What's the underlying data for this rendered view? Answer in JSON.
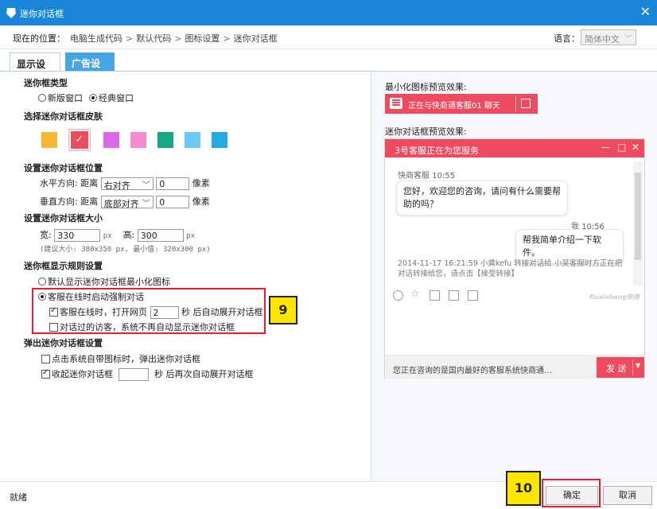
{
  "window": {
    "title": "迷你对话框",
    "close_glyph": "✕"
  },
  "location": {
    "label": "现在的位置：",
    "crumbs": [
      "电脑生成代码",
      "默认代码",
      "图标设置",
      "迷你对话框"
    ],
    "separator": ">",
    "language_label": "语言：",
    "language_value": "简体中文"
  },
  "tabs": [
    {
      "label": "显示设置",
      "active": true
    },
    {
      "label": "广告设置",
      "active": false
    }
  ],
  "settings": {
    "type_title": "迷你框类型",
    "type_options": [
      {
        "label": "新版窗口",
        "selected": false
      },
      {
        "label": "经典窗口",
        "selected": true
      }
    ],
    "skin_title": "选择迷你对话框皮肤",
    "skin_colors": [
      "#f7b731",
      "#ef4b5e",
      "#d66be6",
      "#f38bd0",
      "#16a883",
      "#6dc8f5",
      "#27a9e5"
    ],
    "skin_selected_index": 1,
    "position_title": "设置迷你对话框位置",
    "horizontal": {
      "label": "水平方向:",
      "dist": "距离",
      "align": "右对齐",
      "value": "0",
      "unit": "像素"
    },
    "vertical": {
      "label": "垂直方向:",
      "dist": "距离",
      "align": "底部对齐",
      "value": "0",
      "unit": "像素"
    },
    "size_title": "设置迷你对话框大小",
    "width_label": "宽:",
    "width_value": "330",
    "height_label": "高:",
    "height_value": "300",
    "px": "px",
    "size_hint": "(建议大小: 380x350 px, 最小值: 320x300 px)",
    "rules_title": "迷你框显示规则设置",
    "rule_default": "默认显示迷你对话框最小化图标",
    "rule_force": "客服在线时启动强制对话",
    "rule_open_prefix": "客服在线时，打开网页",
    "rule_open_value": "2",
    "rule_open_suffix": "秒 后自动展开对话框",
    "rule_visited": "对话过的访客，系统不再自动显示迷你对话框",
    "popup_title": "弹出迷你对话框设置",
    "popup_click": "点击系统自带图标时，弹出迷你对话框",
    "popup_collapse_prefix": "收起迷你对话框",
    "popup_collapse_value": "",
    "popup_collapse_suffix": "秒 后再次自动展开对话框"
  },
  "callouts": {
    "nine": "9",
    "ten": "10"
  },
  "preview": {
    "min_label": "最小化图标预览效果:",
    "min_text": "正在与快商通客服01 聊天",
    "chat_label": "迷你对话框预览效果:",
    "chat_header": "3号客服正在为您服务",
    "ctrl_minimize": "—",
    "ctrl_maximize": "□",
    "ctrl_close": "✕",
    "agent_name": "快商客服  10:55",
    "agent_msg": "您好，欢迎您的咨询，请问有什么需要帮助的吗？",
    "me_name": "我  10:56",
    "me_msg": "帮我简单介绍一下软件。",
    "system_msg": "2014-11-17 16:21:59 小龚kefu 转接对话给 小吴客服时方正在把对话转接给您，请点击【接受转接】",
    "brand": "Kuaishang快商",
    "footer_text": "您正在咨询的是国内最好的客服系统快商通…",
    "send_label": "发 送"
  },
  "status": {
    "text": "就绪"
  },
  "buttons": {
    "ok": "确定",
    "cancel": "取消"
  },
  "colors": {
    "titlebar": "#1a86d8",
    "accent": "#ef4b5e",
    "callout": "#e2232e",
    "badge": "#ffe600"
  }
}
